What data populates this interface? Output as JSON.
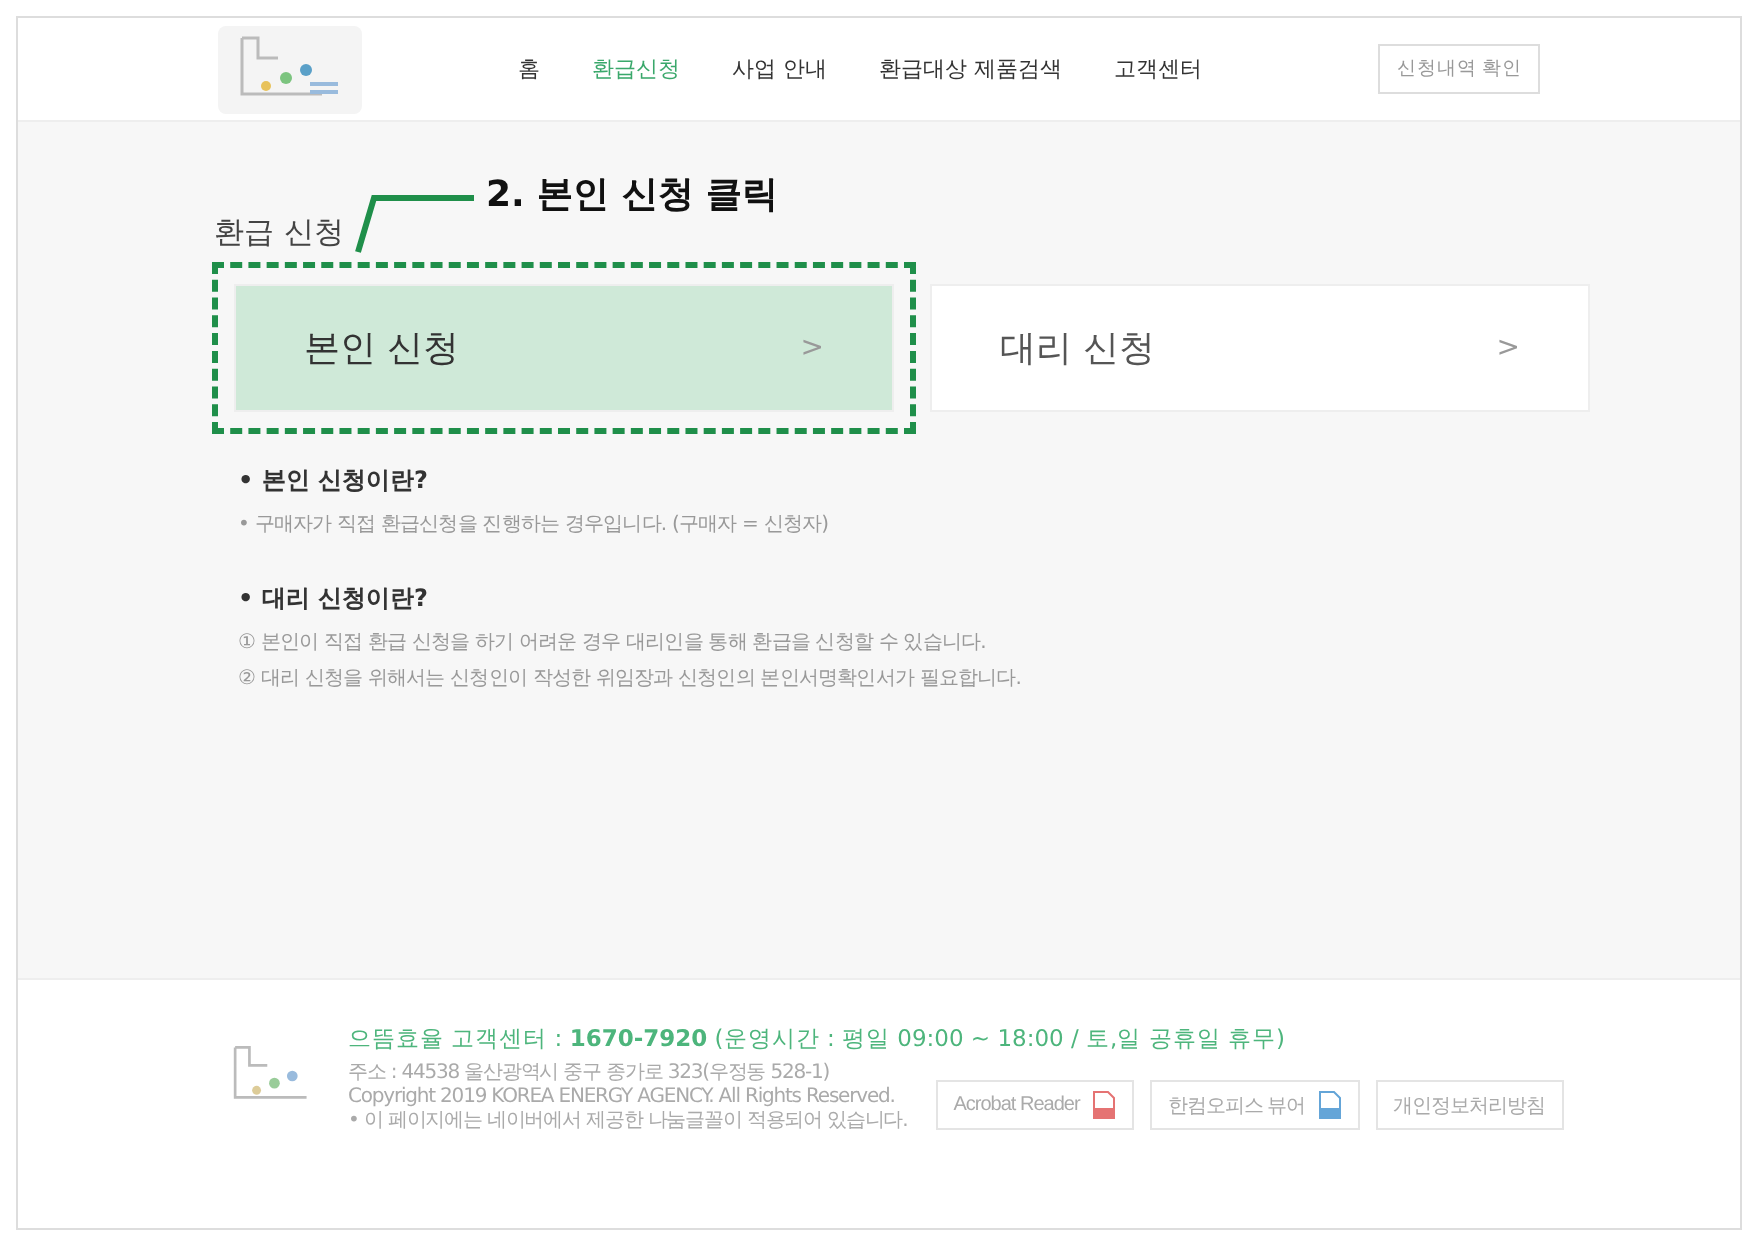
{
  "header": {
    "nav": [
      {
        "label": "홈",
        "selected": false
      },
      {
        "label": "환급신청",
        "selected": true
      },
      {
        "label": "사업 안내",
        "selected": false
      },
      {
        "label": "환급대상 제품검색",
        "selected": false
      },
      {
        "label": "고객센터",
        "selected": false
      }
    ],
    "history_button": "신청내역 확인"
  },
  "page_title": "환급 신청",
  "options": [
    {
      "label": "본인 신청",
      "arrow": ">",
      "highlighted": true
    },
    {
      "label": "대리 신청",
      "arrow": ">",
      "highlighted": false
    }
  ],
  "annotation": {
    "label": "2. 본인 신청 클릭"
  },
  "sections": [
    {
      "heading": "• 본인 신청이란?",
      "lines": [
        "• 구매자가 직접 환급신청을 진행하는 경우입니다. (구매자 = 신청자)"
      ]
    },
    {
      "heading": "• 대리 신청이란?",
      "lines": [
        "① 본인이 직접 환급 신청을 하기 어려운 경우 대리인을 통해 환급을 신청할 수 있습니다.",
        "② 대리 신청을 위해서는 신청인이 작성한 위임장과 신청인의 본인서명확인서가 필요합니다."
      ]
    }
  ],
  "footer": {
    "contact": "으뜸효율 고객센터 : **1670-7920**  (운영시간 : 평일 09:00 ~ 18:00 / 토,일 공휴일 휴무)",
    "lines": [
      "주소 : 44538 울산광역시 중구 종가로 323(우정동 528-1)",
      "Copyright 2019 KOREA ENERGY AGENCY. All Rights Reserved.",
      "• 이 페이지에는 네이버에서 제공한 나눔글꼴이 적용되어 있습니다."
    ],
    "buttons": [
      {
        "label": "Acrobat Reader",
        "kind": "pdf"
      },
      {
        "label": "한컴오피스 뷰어",
        "kind": "doc"
      },
      {
        "label": "개인정보처리방침",
        "kind": "plain"
      }
    ]
  }
}
